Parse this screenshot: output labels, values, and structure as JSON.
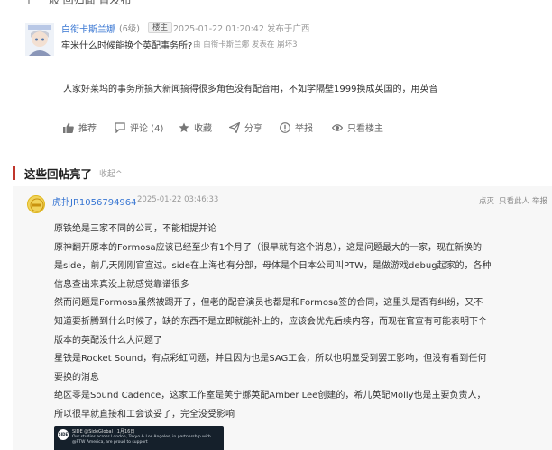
{
  "top_fragment": "一个 一般 回归面 首发布",
  "post": {
    "username": "白衔卡斯兰娜",
    "level": "(6级)",
    "badge": "楼主",
    "timestamp": "2025-01-22 01:20:42 发布于广西",
    "title": "牢米什么时候能换个英配事务所?",
    "quote": "由 白衔卡斯兰娜 发表在 崩坏3",
    "body": "人家好莱坞的事务所搞大新闻搞得很多角色没有配音用，不如学隔壁1999换成英国的，用英音",
    "actions": [
      {
        "icon": "thumb-up-icon",
        "label": "推荐"
      },
      {
        "icon": "comment-icon",
        "label": "评论 (4)"
      },
      {
        "icon": "star-icon",
        "label": "收藏"
      },
      {
        "icon": "share-icon",
        "label": "分享"
      },
      {
        "icon": "report-icon",
        "label": "举报"
      },
      {
        "icon": "eye-icon",
        "label": "只看楼主"
      }
    ]
  },
  "section": {
    "title": "这些回帖亮了",
    "collapse": "收起^"
  },
  "reply": {
    "username": "虎扑JR1056794964",
    "timestamp": "2025-01-22 03:46:33",
    "actions": [
      "点灭",
      "只看此人",
      "举报"
    ],
    "lines": [
      "原铁绝是三家不同的公司，不能相提并论",
      "原神翻开原本的Formosa应该已经至少有1个月了（很早就有这个消息），这是问题最大的一家，现在新换的",
      "是side，前几天刚刚官宣过。side在上海也有分部，母体是个日本公司叫PTW，是做游戏debug起家的，各种",
      "信息查出来真没上就感觉靠谱很多",
      "然而问题是Formosa虽然被踢开了，但老的配音演员也都是和Formosa签的合同，这里头是否有纠纷，又不",
      "知道要折腾到什么时候了，缺的东西不是立即就能补上的，应该会优先后续内容，而现在官宣有可能表明下个",
      "版本的英配没什么大问题了",
      "星铁是Rocket Sound，有点彩虹问题，并且因为也是SAG工会，所以也明显受到罢工影响，但没有看到任何",
      "要换的消息",
      "绝区零是Sound Cadence，这家工作室是芙宁娜英配Amber Lee创建的，希儿英配Molly也是主要负责人，",
      "所以很早就直接和工会谈妥了，完全没受影响"
    ],
    "embed": {
      "logo": "SIDE",
      "name": "SIDE @SideGlobal · 1月16日",
      "text": "Our studios across London, Tokyo & Los Angeles, in partnership with @PTW America, are proud to support"
    }
  },
  "colors": {
    "link": "#3574d2",
    "accent": "#c0362c",
    "reply_bg": "#f7f7f7"
  }
}
